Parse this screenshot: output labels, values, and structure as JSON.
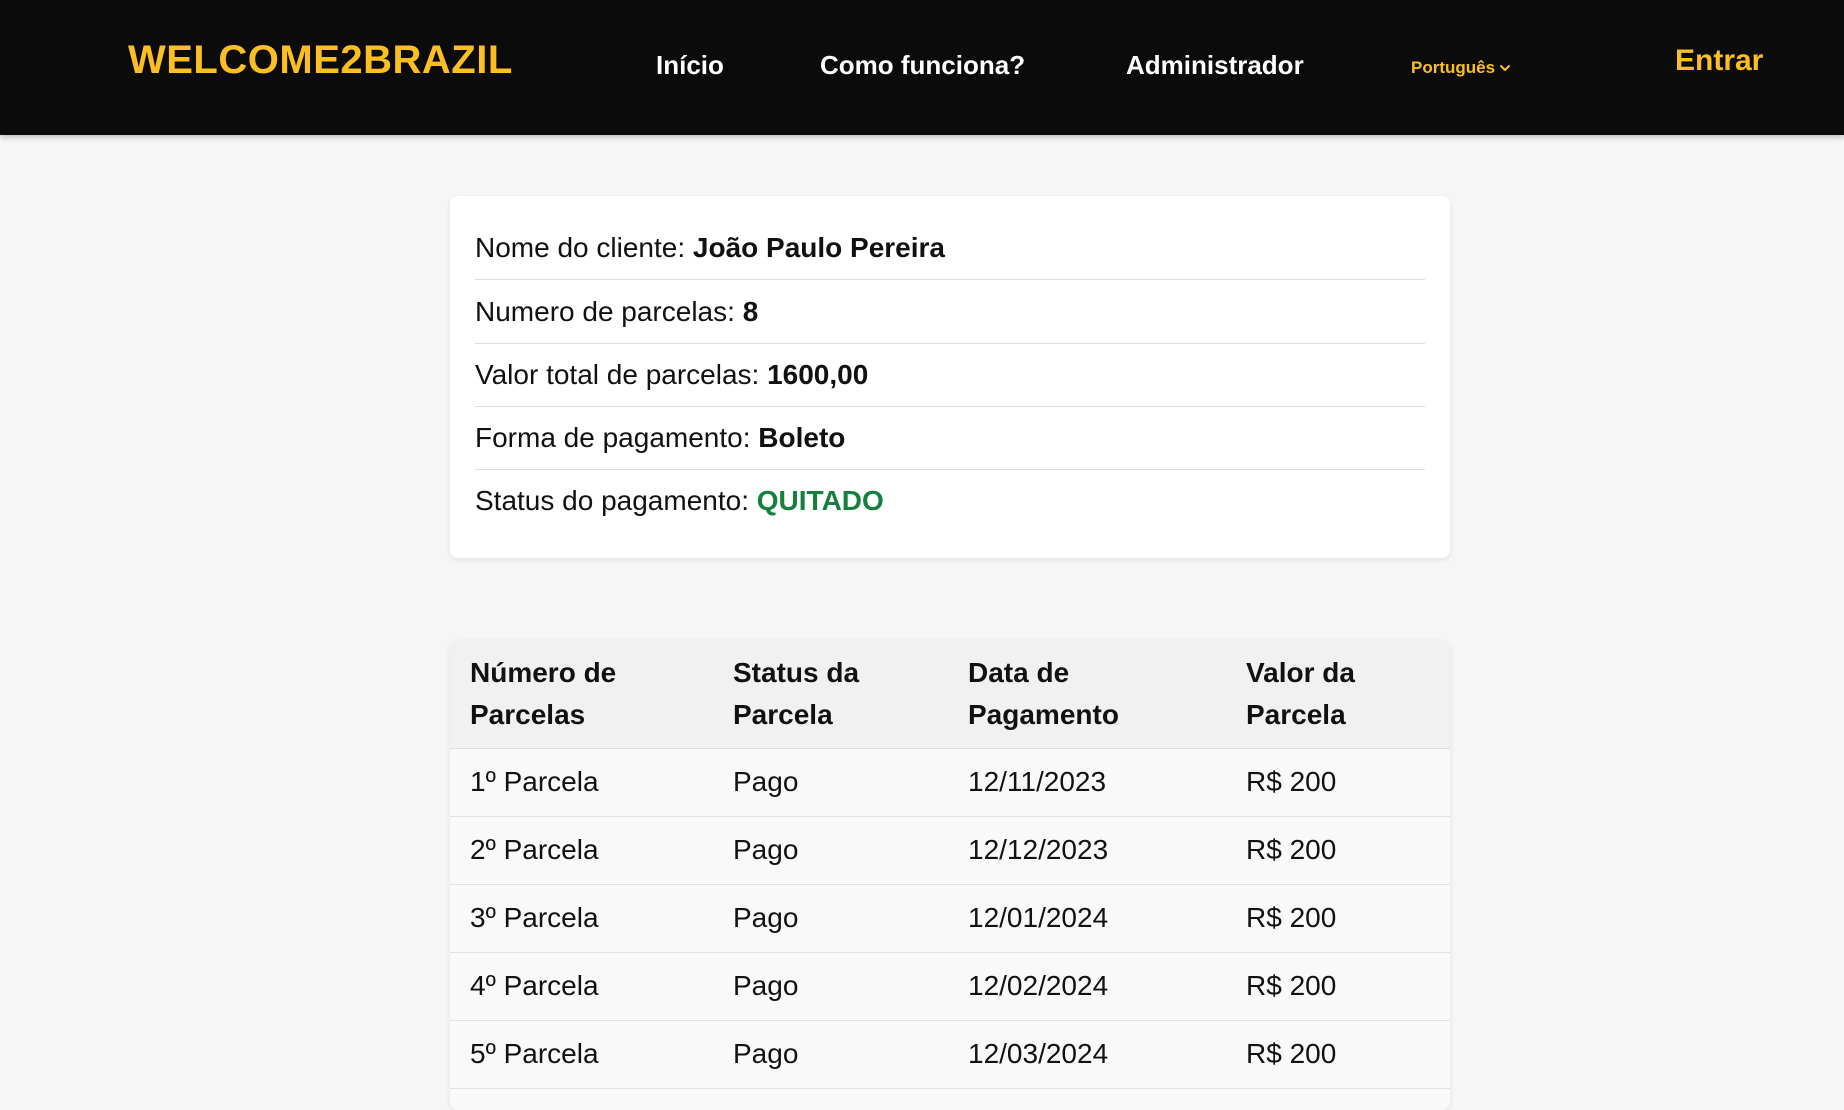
{
  "navbar": {
    "brand": "WELCOME2BRAZIL",
    "links": [
      "Início",
      "Como funciona?",
      "Administrador"
    ],
    "language": "Português",
    "login": "Entrar"
  },
  "summary": {
    "client": {
      "label": "Nome do cliente:",
      "value": "João Paulo Pereira"
    },
    "installments": {
      "label": "Numero de parcelas:",
      "value": "8"
    },
    "total": {
      "label": "Valor total de parcelas:",
      "value": "1600,00"
    },
    "payment_method": {
      "label": "Forma de pagamento:",
      "value": "Boleto"
    },
    "status": {
      "label": "Status do pagamento:",
      "value": "QUITADO",
      "color": "#15803d"
    }
  },
  "table": {
    "headers": [
      "Número de Parcelas",
      "Status da Parcela",
      "Data de Pagamento",
      "Valor da Parcela"
    ],
    "rows": [
      [
        "1º Parcela",
        "Pago",
        "12/11/2023",
        "R$ 200"
      ],
      [
        "2º Parcela",
        "Pago",
        "12/12/2023",
        "R$ 200"
      ],
      [
        "3º Parcela",
        "Pago",
        "12/01/2024",
        "R$ 200"
      ],
      [
        "4º Parcela",
        "Pago",
        "12/02/2024",
        "R$ 200"
      ],
      [
        "5º Parcela",
        "Pago",
        "12/03/2024",
        "R$ 200"
      ]
    ]
  },
  "colors": {
    "brand": "#fbbf24",
    "navbar_bg": "#0b0b0b",
    "page_bg": "#f6f6f6",
    "status_paid": "#15803d"
  }
}
